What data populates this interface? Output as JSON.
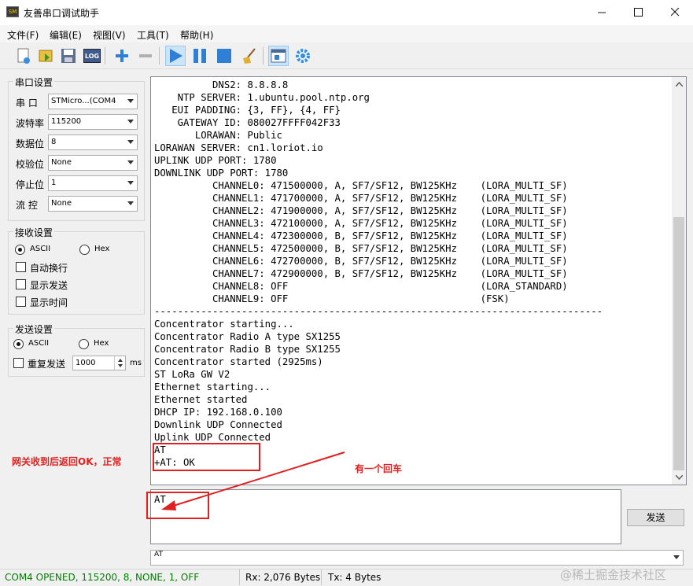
{
  "window": {
    "title": "友善串口调试助手",
    "icon_text": "SM",
    "minimize_icon": "minimize-icon",
    "maximize_icon": "maximize-icon",
    "close_icon": "close-icon"
  },
  "menu": [
    "文件(F)",
    "编辑(E)",
    "视图(V)",
    "工具(T)",
    "帮助(H)"
  ],
  "toolbar": {
    "log_label": "LOG",
    "icons": [
      "new-icon",
      "open-icon",
      "save-icon",
      "log-icon",
      "add-icon",
      "remove-icon",
      "play-icon",
      "pause-icon",
      "stop-icon",
      "clear-icon",
      "new-window-icon",
      "settings-icon"
    ]
  },
  "serial": {
    "title": "串口设置",
    "port_label": "串 口",
    "port_value": "STMicro...(COM4",
    "baud_label": "波特率",
    "baud_value": "115200",
    "databits_label": "数据位",
    "databits_value": "8",
    "parity_label": "校验位",
    "parity_value": "None",
    "stopbits_label": "停止位",
    "stopbits_value": "1",
    "flow_label": "流 控",
    "flow_value": "None"
  },
  "receive": {
    "title": "接收设置",
    "ascii_label": "ASCII",
    "hex_label": "Hex",
    "mode": "ASCII",
    "autowrap_label": "自动换行",
    "showsend_label": "显示发送",
    "showtime_label": "显示时间"
  },
  "send": {
    "title": "发送设置",
    "ascii_label": "ASCII",
    "hex_label": "Hex",
    "mode": "ASCII",
    "repeat_label": "重复发送",
    "interval_value": "1000",
    "interval_unit": "ms"
  },
  "terminal": {
    "lines": [
      "          DNS2: 8.8.8.8",
      "    NTP SERVER: 1.ubuntu.pool.ntp.org",
      "   EUI PADDING: {3, FF}, {4, FF}",
      "    GATEWAY ID: 080027FFFF042F33",
      "       LORAWAN: Public",
      "LORAWAN SERVER: cn1.loriot.io",
      "UPLINK UDP PORT: 1780",
      "DOWNLINK UDP PORT: 1780",
      "          CHANNEL0: 471500000, A, SF7/SF12, BW125KHz    (LORA_MULTI_SF)",
      "          CHANNEL1: 471700000, A, SF7/SF12, BW125KHz    (LORA_MULTI_SF)",
      "          CHANNEL2: 471900000, A, SF7/SF12, BW125KHz    (LORA_MULTI_SF)",
      "          CHANNEL3: 472100000, A, SF7/SF12, BW125KHz    (LORA_MULTI_SF)",
      "          CHANNEL4: 472300000, B, SF7/SF12, BW125KHz    (LORA_MULTI_SF)",
      "          CHANNEL5: 472500000, B, SF7/SF12, BW125KHz    (LORA_MULTI_SF)",
      "          CHANNEL6: 472700000, B, SF7/SF12, BW125KHz    (LORA_MULTI_SF)",
      "          CHANNEL7: 472900000, B, SF7/SF12, BW125KHz    (LORA_MULTI_SF)",
      "          CHANNEL8: OFF                                 (LORA_STANDARD)",
      "          CHANNEL9: OFF                                 (FSK)",
      "-----------------------------------------------------------------------------",
      "Concentrator starting...",
      "Concentrator Radio A type SX1255",
      "Concentrator Radio B type SX1255",
      "Concentrator started (2925ms)",
      "ST LoRa GW V2",
      "Ethernet starting...",
      "Ethernet started",
      "DHCP IP: 192.168.0.100",
      "Downlink UDP Connected",
      "Uplink UDP Connected",
      "AT",
      "+AT: OK"
    ]
  },
  "send_area": {
    "text": "AT",
    "send_button": "发送",
    "history_value": "AT"
  },
  "annotations": {
    "left_note": "网关收到后返回OK，正常",
    "right_note": "有一个回车",
    "color": "#e02020"
  },
  "status": {
    "port_status": "COM4 OPENED, 115200, 8, NONE, 1, OFF",
    "rx": "Rx: 2,076 Bytes",
    "tx": "Tx: 4 Bytes",
    "watermark": "@稀土掘金技术社区",
    "port_status_color": "#008000"
  }
}
